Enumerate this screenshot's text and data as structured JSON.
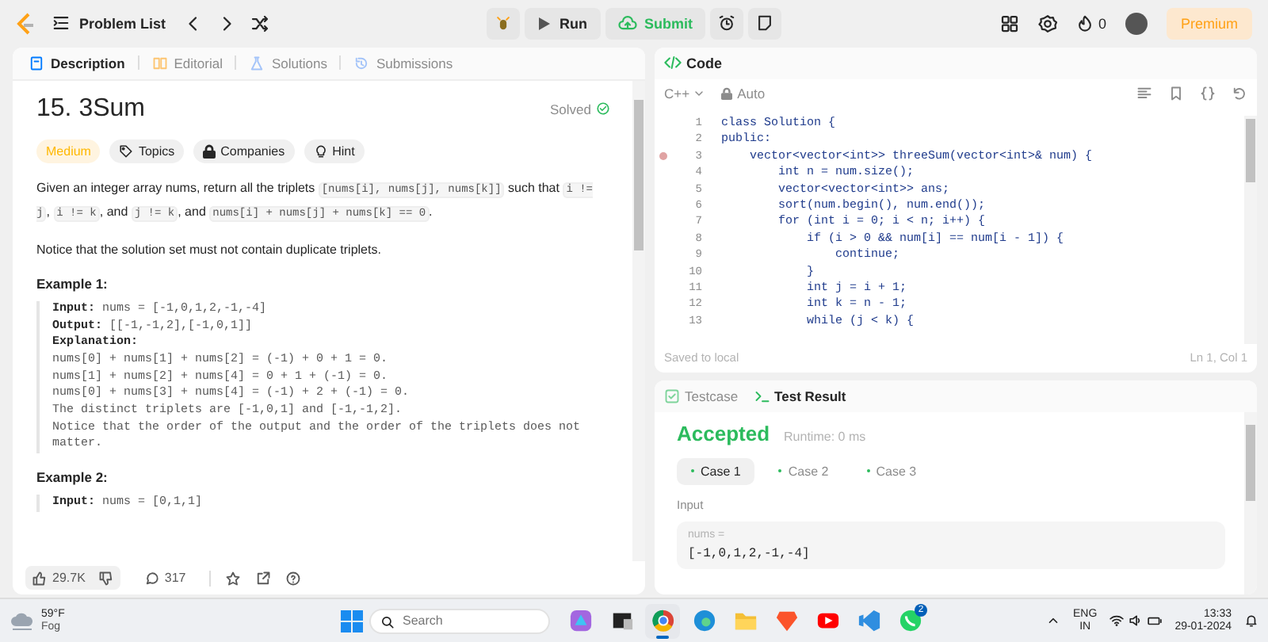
{
  "topbar": {
    "problem_list": "Problem List",
    "run": "Run",
    "submit": "Submit",
    "streak": "0",
    "premium": "Premium"
  },
  "description": {
    "tabs": [
      {
        "label": "Description",
        "selected": true
      },
      {
        "label": "Editorial",
        "selected": false
      },
      {
        "label": "Solutions",
        "selected": false
      },
      {
        "label": "Submissions",
        "selected": false
      }
    ],
    "title": "15. 3Sum",
    "status": "Solved",
    "tags": [
      {
        "kind": "difficulty",
        "label": "Medium"
      },
      {
        "kind": "topics",
        "label": "Topics"
      },
      {
        "kind": "companies",
        "label": "Companies"
      },
      {
        "kind": "hint",
        "label": "Hint"
      }
    ],
    "paragraphs": [
      [
        {
          "text": "Given an integer array nums, return all the triplets ",
          "code": false
        },
        {
          "text": "[nums[i], nums[j], nums[k]]",
          "code": true
        },
        {
          "text": " such that ",
          "code": false
        },
        {
          "text": "i != j",
          "code": true
        },
        {
          "text": ", ",
          "code": false
        },
        {
          "text": "i != k",
          "code": true
        },
        {
          "text": ", and ",
          "code": false
        },
        {
          "text": "j != k",
          "code": true
        },
        {
          "text": ", and ",
          "code": false
        },
        {
          "text": "nums[i] + nums[j] + nums[k] == 0",
          "code": true
        },
        {
          "text": ".",
          "code": false
        }
      ],
      [
        {
          "text": "Notice that the solution set must not contain duplicate triplets.",
          "code": false
        }
      ]
    ],
    "examples": [
      {
        "heading": "Example 1:",
        "lines": [
          "**Input:** nums = [-1,0,1,2,-1,-4]",
          "**Output:** [[-1,-1,2],[-1,0,1]]",
          "**Explanation:**",
          "nums[0] + nums[1] + nums[2] = (-1) + 0 + 1 = 0.",
          "nums[1] + nums[2] + nums[4] = 0 + 1 + (-1) = 0.",
          "nums[0] + nums[3] + nums[4] = (-1) + 2 + (-1) = 0.",
          "The distinct triplets are [-1,0,1] and [-1,-1,2].",
          "Notice that the order of the output and the order of the triplets does not matter."
        ]
      },
      {
        "heading": "Example 2:",
        "lines": [
          "**Input:** nums = [0,1,1]"
        ]
      }
    ],
    "footer": {
      "likes": "29.7K",
      "comments": "317"
    }
  },
  "code": {
    "title": "Code",
    "language": "C++",
    "mode": "Auto",
    "lines": [
      {
        "number": "1",
        "text": "class Solution {",
        "breakpoint": false
      },
      {
        "number": "2",
        "text": "public:",
        "breakpoint": false
      },
      {
        "number": "3",
        "text": "    vector<vector<int>> threeSum(vector<int>& num) {",
        "breakpoint": true
      },
      {
        "number": "4",
        "text": "        int n = num.size();",
        "breakpoint": false
      },
      {
        "number": "5",
        "text": "        vector<vector<int>> ans;",
        "breakpoint": false
      },
      {
        "number": "6",
        "text": "        sort(num.begin(), num.end());",
        "breakpoint": false
      },
      {
        "number": "7",
        "text": "        for (int i = 0; i < n; i++) {",
        "breakpoint": false
      },
      {
        "number": "8",
        "text": "            if (i > 0 && num[i] == num[i - 1]) {",
        "breakpoint": false
      },
      {
        "number": "9",
        "text": "                continue;",
        "breakpoint": false
      },
      {
        "number": "10",
        "text": "            }",
        "breakpoint": false
      },
      {
        "number": "11",
        "text": "            int j = i + 1;",
        "breakpoint": false
      },
      {
        "number": "12",
        "text": "            int k = n - 1;",
        "breakpoint": false
      },
      {
        "number": "13",
        "text": "            while (j < k) {",
        "breakpoint": false
      }
    ],
    "status": "Saved to local",
    "cursor": "Ln 1, Col 1"
  },
  "result": {
    "tabs": [
      {
        "label": "Testcase",
        "selected": false
      },
      {
        "label": "Test Result",
        "selected": true
      }
    ],
    "verdict": "Accepted",
    "runtime": "Runtime: 0 ms",
    "cases": [
      {
        "label": "Case 1",
        "selected": true
      },
      {
        "label": "Case 2",
        "selected": false
      },
      {
        "label": "Case 3",
        "selected": false
      }
    ],
    "input_label": "Input",
    "param_name": "nums =",
    "param_value": "[-1,0,1,2,-1,-4]"
  },
  "taskbar": {
    "temperature": "59°F",
    "condition": "Fog",
    "search_placeholder": "Search",
    "apps": [
      {
        "kind": "copilot",
        "selected": false
      },
      {
        "kind": "taskview",
        "selected": false
      },
      {
        "kind": "chrome",
        "selected": true
      },
      {
        "kind": "edge",
        "selected": false
      },
      {
        "kind": "files",
        "selected": false
      },
      {
        "kind": "brave",
        "selected": false
      },
      {
        "kind": "youtube",
        "selected": false
      },
      {
        "kind": "vscode",
        "selected": false
      },
      {
        "kind": "whatsapp",
        "selected": false,
        "badge": "2"
      }
    ],
    "language": "ENG",
    "region": "IN",
    "time": "13:33",
    "date": "29-01-2024"
  }
}
